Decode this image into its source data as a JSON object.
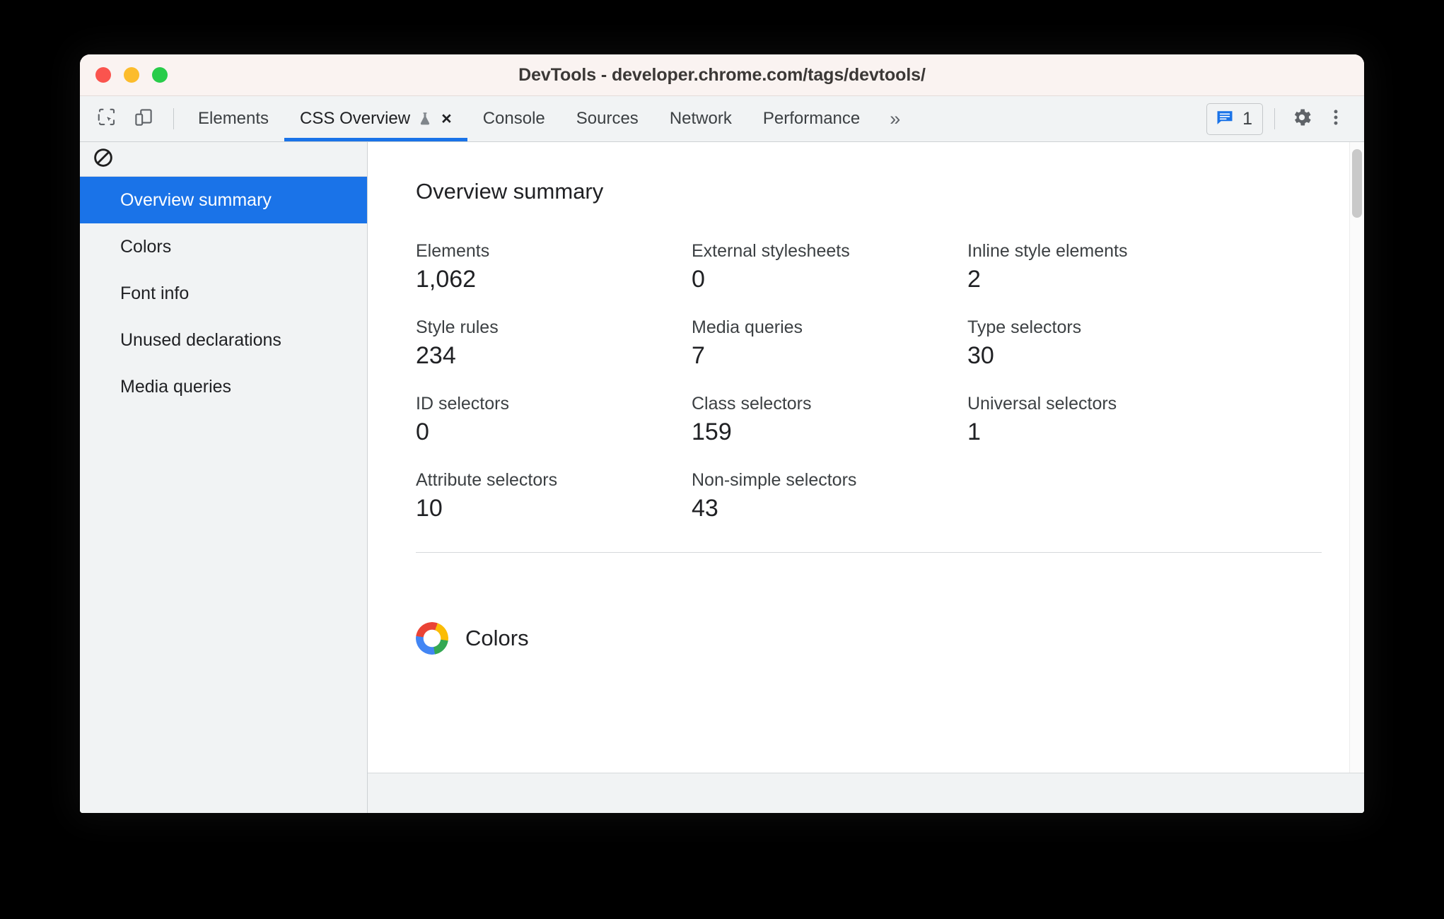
{
  "window": {
    "title": "DevTools - developer.chrome.com/tags/devtools/",
    "traffic_lights": [
      {
        "name": "close",
        "color": "#fa544e"
      },
      {
        "name": "minimize",
        "color": "#fcbc2c"
      },
      {
        "name": "zoom",
        "color": "#28cc4a"
      }
    ]
  },
  "toolbar": {
    "inspect_icon": "inspect-element-icon",
    "device_icon": "device-toolbar-icon",
    "tabs": [
      {
        "label": "Elements",
        "active": false
      },
      {
        "label": "CSS Overview",
        "active": true,
        "experiment_icon": "flask-icon",
        "close_label": "×"
      },
      {
        "label": "Console",
        "active": false
      },
      {
        "label": "Sources",
        "active": false
      },
      {
        "label": "Network",
        "active": false
      },
      {
        "label": "Performance",
        "active": false
      }
    ],
    "overflow_label": "»",
    "issues": {
      "icon": "issues-message-icon",
      "count": "1"
    },
    "settings_icon": "gear-icon",
    "more_icon": "three-dot-menu-icon",
    "accent_color": "#1a73e8"
  },
  "sidebar": {
    "clear_icon": "block-clear-icon",
    "items": [
      {
        "label": "Overview summary",
        "selected": true
      },
      {
        "label": "Colors",
        "selected": false
      },
      {
        "label": "Font info",
        "selected": false
      },
      {
        "label": "Unused declarations",
        "selected": false
      },
      {
        "label": "Media queries",
        "selected": false
      }
    ],
    "selected_bg": "#1a73e8"
  },
  "main": {
    "title": "Overview summary",
    "metrics": [
      {
        "label": "Elements",
        "value": "1,062"
      },
      {
        "label": "External stylesheets",
        "value": "0"
      },
      {
        "label": "Inline style elements",
        "value": "2"
      },
      {
        "label": "Style rules",
        "value": "234"
      },
      {
        "label": "Media queries",
        "value": "7"
      },
      {
        "label": "Type selectors",
        "value": "30"
      },
      {
        "label": "ID selectors",
        "value": "0"
      },
      {
        "label": "Class selectors",
        "value": "159"
      },
      {
        "label": "Universal selectors",
        "value": "1"
      },
      {
        "label": "Attribute selectors",
        "value": "10"
      },
      {
        "label": "Non-simple selectors",
        "value": "43"
      }
    ],
    "colors_section": {
      "title": "Colors",
      "icon": "color-wheel-icon"
    }
  }
}
